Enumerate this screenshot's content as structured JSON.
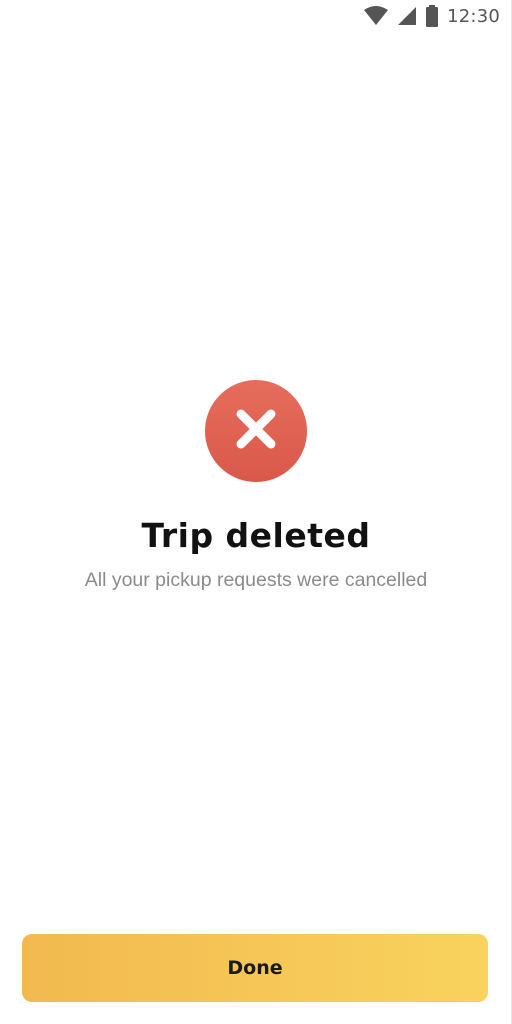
{
  "status_bar": {
    "time": "12:30",
    "icons": [
      "wifi-icon",
      "cellular-signal-icon",
      "battery-icon"
    ]
  },
  "result": {
    "icon": "close-icon",
    "icon_color": "#E0604F",
    "title": "Trip deleted",
    "subtitle": "All your pickup requests were cancelled"
  },
  "actions": {
    "done_label": "Done",
    "done_color_start": "#F2B94F",
    "done_color_end": "#F9D35E"
  }
}
